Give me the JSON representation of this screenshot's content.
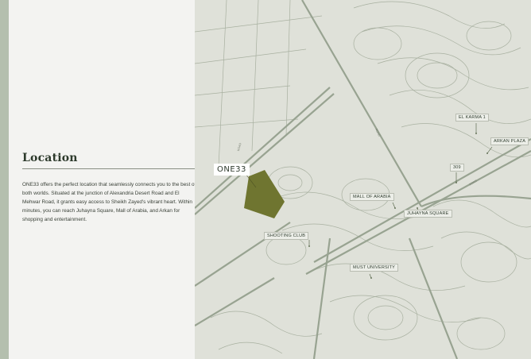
{
  "panel": {
    "title": "Location",
    "description": "ONE33 offers the perfect location that seamlessly connects you to the best of both worlds. Situated at the junction of Alexandria Desert Road and El Mehwar Road, it grants easy access to Sheikh Zayed's vibrant heart. Within minutes, you can reach Juhayna Square, Mall of Arabia, and Arkan for shopping and entertainment."
  },
  "map": {
    "project_label": "ONE33",
    "landmarks": [
      {
        "id": "el-karma-1",
        "label": "EL KARMA 1"
      },
      {
        "id": "arkan-plaza",
        "label": "ARKAN PLAZA"
      },
      {
        "id": "zone-309",
        "label": "309"
      },
      {
        "id": "mall-of-arabia",
        "label": "MALL OF ARABIA"
      },
      {
        "id": "juhayna-square",
        "label": "JUHAYNA SQUARE"
      },
      {
        "id": "shooting-club",
        "label": "SHOOTING CLUB"
      },
      {
        "id": "must-university",
        "label": "MUST UNIVERSITY"
      }
    ],
    "roads": {
      "road_a": "ROAD",
      "road_b": "ROAD",
      "road_c": "ROAD"
    },
    "colors": {
      "land": "#dfe1d9",
      "roads": "#a8b0a0",
      "major_roads": "#98a391",
      "plot": "#6f7530",
      "label_bg": "#eceee8"
    }
  }
}
